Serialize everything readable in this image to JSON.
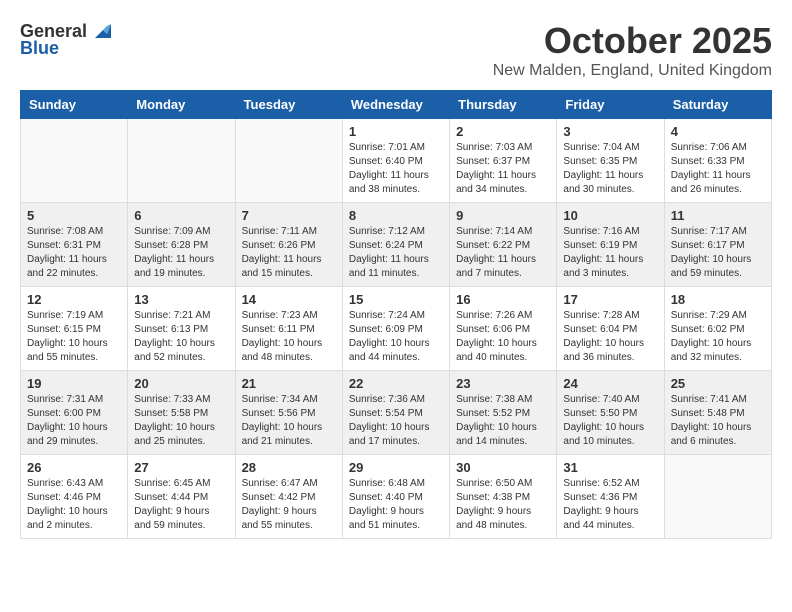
{
  "header": {
    "logo_general": "General",
    "logo_blue": "Blue",
    "month": "October 2025",
    "location": "New Malden, England, United Kingdom"
  },
  "weekdays": [
    "Sunday",
    "Monday",
    "Tuesday",
    "Wednesday",
    "Thursday",
    "Friday",
    "Saturday"
  ],
  "weeks": [
    [
      {
        "day": "",
        "info": ""
      },
      {
        "day": "",
        "info": ""
      },
      {
        "day": "",
        "info": ""
      },
      {
        "day": "1",
        "info": "Sunrise: 7:01 AM\nSunset: 6:40 PM\nDaylight: 11 hours\nand 38 minutes."
      },
      {
        "day": "2",
        "info": "Sunrise: 7:03 AM\nSunset: 6:37 PM\nDaylight: 11 hours\nand 34 minutes."
      },
      {
        "day": "3",
        "info": "Sunrise: 7:04 AM\nSunset: 6:35 PM\nDaylight: 11 hours\nand 30 minutes."
      },
      {
        "day": "4",
        "info": "Sunrise: 7:06 AM\nSunset: 6:33 PM\nDaylight: 11 hours\nand 26 minutes."
      }
    ],
    [
      {
        "day": "5",
        "info": "Sunrise: 7:08 AM\nSunset: 6:31 PM\nDaylight: 11 hours\nand 22 minutes."
      },
      {
        "day": "6",
        "info": "Sunrise: 7:09 AM\nSunset: 6:28 PM\nDaylight: 11 hours\nand 19 minutes."
      },
      {
        "day": "7",
        "info": "Sunrise: 7:11 AM\nSunset: 6:26 PM\nDaylight: 11 hours\nand 15 minutes."
      },
      {
        "day": "8",
        "info": "Sunrise: 7:12 AM\nSunset: 6:24 PM\nDaylight: 11 hours\nand 11 minutes."
      },
      {
        "day": "9",
        "info": "Sunrise: 7:14 AM\nSunset: 6:22 PM\nDaylight: 11 hours\nand 7 minutes."
      },
      {
        "day": "10",
        "info": "Sunrise: 7:16 AM\nSunset: 6:19 PM\nDaylight: 11 hours\nand 3 minutes."
      },
      {
        "day": "11",
        "info": "Sunrise: 7:17 AM\nSunset: 6:17 PM\nDaylight: 10 hours\nand 59 minutes."
      }
    ],
    [
      {
        "day": "12",
        "info": "Sunrise: 7:19 AM\nSunset: 6:15 PM\nDaylight: 10 hours\nand 55 minutes."
      },
      {
        "day": "13",
        "info": "Sunrise: 7:21 AM\nSunset: 6:13 PM\nDaylight: 10 hours\nand 52 minutes."
      },
      {
        "day": "14",
        "info": "Sunrise: 7:23 AM\nSunset: 6:11 PM\nDaylight: 10 hours\nand 48 minutes."
      },
      {
        "day": "15",
        "info": "Sunrise: 7:24 AM\nSunset: 6:09 PM\nDaylight: 10 hours\nand 44 minutes."
      },
      {
        "day": "16",
        "info": "Sunrise: 7:26 AM\nSunset: 6:06 PM\nDaylight: 10 hours\nand 40 minutes."
      },
      {
        "day": "17",
        "info": "Sunrise: 7:28 AM\nSunset: 6:04 PM\nDaylight: 10 hours\nand 36 minutes."
      },
      {
        "day": "18",
        "info": "Sunrise: 7:29 AM\nSunset: 6:02 PM\nDaylight: 10 hours\nand 32 minutes."
      }
    ],
    [
      {
        "day": "19",
        "info": "Sunrise: 7:31 AM\nSunset: 6:00 PM\nDaylight: 10 hours\nand 29 minutes."
      },
      {
        "day": "20",
        "info": "Sunrise: 7:33 AM\nSunset: 5:58 PM\nDaylight: 10 hours\nand 25 minutes."
      },
      {
        "day": "21",
        "info": "Sunrise: 7:34 AM\nSunset: 5:56 PM\nDaylight: 10 hours\nand 21 minutes."
      },
      {
        "day": "22",
        "info": "Sunrise: 7:36 AM\nSunset: 5:54 PM\nDaylight: 10 hours\nand 17 minutes."
      },
      {
        "day": "23",
        "info": "Sunrise: 7:38 AM\nSunset: 5:52 PM\nDaylight: 10 hours\nand 14 minutes."
      },
      {
        "day": "24",
        "info": "Sunrise: 7:40 AM\nSunset: 5:50 PM\nDaylight: 10 hours\nand 10 minutes."
      },
      {
        "day": "25",
        "info": "Sunrise: 7:41 AM\nSunset: 5:48 PM\nDaylight: 10 hours\nand 6 minutes."
      }
    ],
    [
      {
        "day": "26",
        "info": "Sunrise: 6:43 AM\nSunset: 4:46 PM\nDaylight: 10 hours\nand 2 minutes."
      },
      {
        "day": "27",
        "info": "Sunrise: 6:45 AM\nSunset: 4:44 PM\nDaylight: 9 hours\nand 59 minutes."
      },
      {
        "day": "28",
        "info": "Sunrise: 6:47 AM\nSunset: 4:42 PM\nDaylight: 9 hours\nand 55 minutes."
      },
      {
        "day": "29",
        "info": "Sunrise: 6:48 AM\nSunset: 4:40 PM\nDaylight: 9 hours\nand 51 minutes."
      },
      {
        "day": "30",
        "info": "Sunrise: 6:50 AM\nSunset: 4:38 PM\nDaylight: 9 hours\nand 48 minutes."
      },
      {
        "day": "31",
        "info": "Sunrise: 6:52 AM\nSunset: 4:36 PM\nDaylight: 9 hours\nand 44 minutes."
      },
      {
        "day": "",
        "info": ""
      }
    ]
  ]
}
